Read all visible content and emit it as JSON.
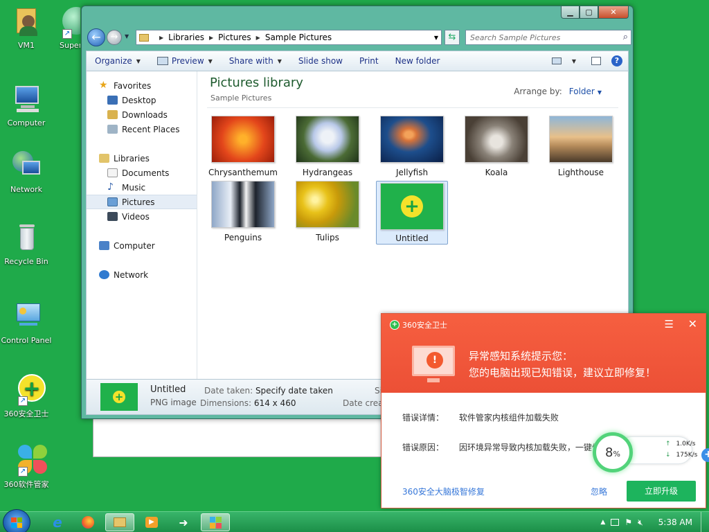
{
  "desktop": {
    "icons": [
      {
        "label": "VM1"
      },
      {
        "label": "Super"
      },
      {
        "label": "Computer"
      },
      {
        "label": "Network"
      },
      {
        "label": "Recycle Bin"
      },
      {
        "label": "Control Panel"
      },
      {
        "label": "360安全卫士"
      },
      {
        "label": "360软件管家"
      }
    ]
  },
  "explorer": {
    "address": {
      "crumbs": [
        "Libraries",
        "Pictures",
        "Sample Pictures"
      ],
      "search_placeholder": "Search Sample Pictures"
    },
    "toolbar": {
      "organize": "Organize",
      "preview": "Preview",
      "share_with": "Share with",
      "slide_show": "Slide show",
      "print": "Print",
      "new_folder": "New folder"
    },
    "nav": {
      "favorites": "Favorites",
      "desktop": "Desktop",
      "downloads": "Downloads",
      "recent_places": "Recent Places",
      "libraries": "Libraries",
      "documents": "Documents",
      "music": "Music",
      "pictures": "Pictures",
      "videos": "Videos",
      "computer": "Computer",
      "network": "Network"
    },
    "content": {
      "title": "Pictures library",
      "subtitle": "Sample Pictures",
      "arrange_label": "Arrange by:",
      "arrange_value": "Folder",
      "items": [
        {
          "name": "Chrysanthemum",
          "color": "#e3461b"
        },
        {
          "name": "Hydrangeas",
          "color": "#4b6b35"
        },
        {
          "name": "Jellyfish",
          "color": "#1d4e8c"
        },
        {
          "name": "Koala",
          "color": "#8a8278"
        },
        {
          "name": "Lighthouse",
          "color": "#b48a5a"
        },
        {
          "name": "Penguins",
          "color": "#8fa7c7"
        },
        {
          "name": "Tulips",
          "color": "#e8c21a"
        },
        {
          "name": "Untitled",
          "color": "#20b14b"
        }
      ]
    },
    "details": {
      "name": "Untitled",
      "type": "PNG image",
      "date_taken_label": "Date taken:",
      "date_taken_value": "Specify date taken",
      "dimensions_label": "Dimensions:",
      "dimensions_value": "614 x 460",
      "size_label": "Siz",
      "date_created_label": "Date created"
    }
  },
  "popup": {
    "brand": "360安全卫士",
    "headline_1": "异常感知系统提示您：",
    "headline_2": "您的电脑出现已知错误，建议立即修复！",
    "detail_label": "错误详情：",
    "detail_value": "软件管家内核组件加载失败",
    "reason_label": "错误原因：",
    "reason_value": "因环境异常导致内核加载失败，一键修",
    "link": "360安全大脑极智修复",
    "ignore": "忽略",
    "upgrade": "立即升级"
  },
  "accelerator": {
    "percent": "8",
    "percent_sign": "%",
    "up_speed": "1.0K/s",
    "down_speed": "175K/s"
  },
  "taskbar": {
    "clock": "5:38 AM"
  }
}
